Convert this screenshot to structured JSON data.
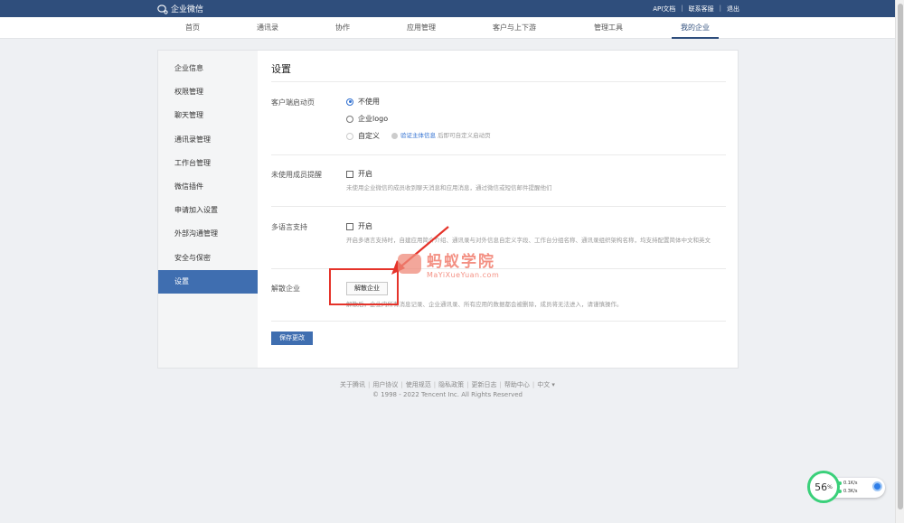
{
  "topbar": {
    "brand": "企业微信",
    "links": [
      "API文档",
      "联系客服",
      "退出"
    ]
  },
  "nav": {
    "tabs": [
      {
        "label": "首页"
      },
      {
        "label": "通讯录"
      },
      {
        "label": "协作"
      },
      {
        "label": "应用管理"
      },
      {
        "label": "客户与上下游"
      },
      {
        "label": "管理工具"
      },
      {
        "label": "我的企业",
        "active": true
      }
    ]
  },
  "sidebar": {
    "items": [
      {
        "label": "企业信息"
      },
      {
        "label": "权限管理"
      },
      {
        "label": "聊天管理"
      },
      {
        "label": "通讯录管理"
      },
      {
        "label": "工作台管理"
      },
      {
        "label": "微信插件"
      },
      {
        "label": "申请加入设置"
      },
      {
        "label": "外部沟通管理"
      },
      {
        "label": "安全与保密"
      },
      {
        "label": "设置",
        "active": true
      }
    ]
  },
  "main": {
    "title": "设置",
    "client_startup": {
      "label": "客户端启动页",
      "option_none": "不使用",
      "option_logo": "企业logo",
      "option_custom": "自定义",
      "verify_link": "验证主体信息",
      "verify_suffix": "后即可自定义启动页"
    },
    "inactive_reminder": {
      "label": "未使用成员提醒",
      "checkbox": "开启",
      "hint": "未使用企业微信的成员收到聊天消息和应用消息，通过微信或短信邮件提醒他们"
    },
    "multilang": {
      "label": "多语言支持",
      "checkbox": "开启",
      "hint": "开启多语言支持时，自建应用简介介绍、通讯录与对外信息自定义字段、工作台分组名称、通讯录组织架构名称，均支持配置简体中文和英文"
    },
    "dissolve": {
      "label": "解散企业",
      "button": "解散企业",
      "hint": "解散后，企业内所有消息记录、企业通讯录、所有应用的数据都会被删除，成员将无法进入，请谨慎操作。"
    },
    "save_button": "保存更改"
  },
  "watermark": {
    "title": "蚂蚁学院",
    "subtitle": "MaYiXueYuan.com"
  },
  "footer": {
    "links": [
      "关于腾讯",
      "用户协议",
      "使用规范",
      "隐私政策",
      "更新日志",
      "帮助中心",
      "中文 ▾"
    ],
    "copyright": "© 1998 - 2022 Tencent Inc. All Rights Reserved"
  },
  "speed_widget": {
    "percent": "56",
    "unit": "%",
    "upload": "0.1K/s",
    "download": "0.3K/s"
  },
  "colors": {
    "topbar": "#2f4e7c",
    "active": "#3f6eb0",
    "highlight": "#e5332a",
    "widget_ring": "#3ad07a"
  }
}
